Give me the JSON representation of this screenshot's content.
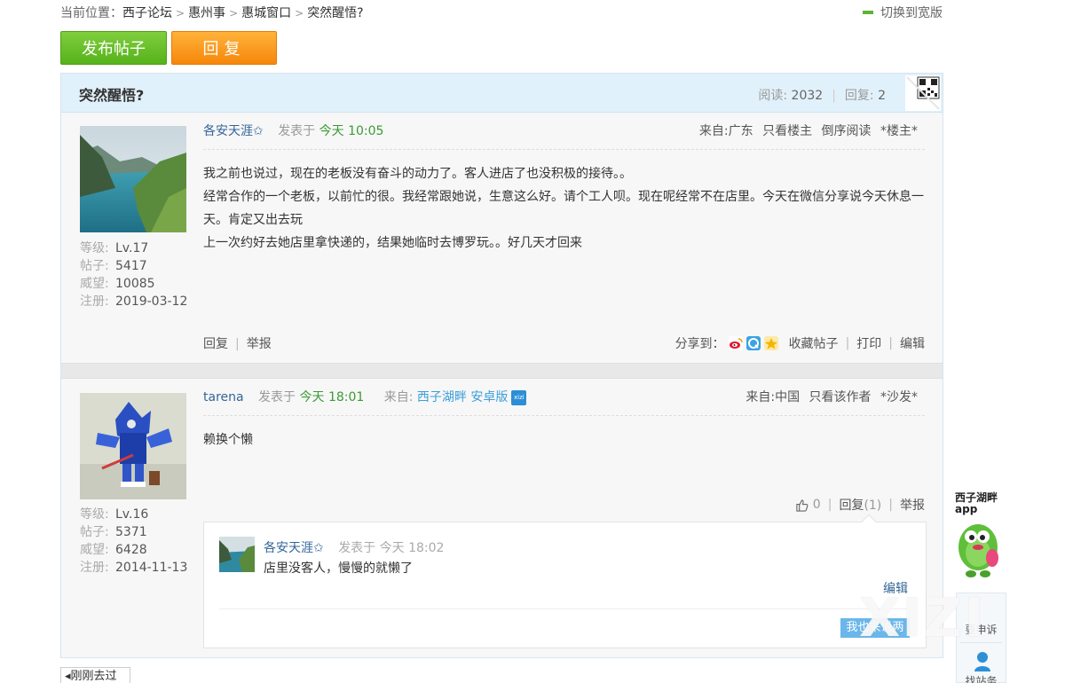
{
  "breadcrumb": {
    "prefix": "当前位置：",
    "items": [
      "西子论坛",
      "惠州事",
      "惠城窗口",
      "突然醒悟?"
    ]
  },
  "wide_toggle": "切换到宽版",
  "buttons": {
    "post": "发布帖子",
    "reply": "回复"
  },
  "thread": {
    "title": "突然醒悟?",
    "read_label": "阅读:",
    "read_count": "2032",
    "reply_label": "回复:",
    "reply_count": "2"
  },
  "posts": [
    {
      "author": "各安天涯✩",
      "posted_label": "发表于",
      "time": "今天 10:05",
      "from": "来自:广东",
      "only_op": "只看楼主",
      "reverse": "倒序阅读",
      "floor": "*楼主*",
      "stats": [
        {
          "k": "等级:",
          "v": "Lv.17"
        },
        {
          "k": "帖子:",
          "v": "5417"
        },
        {
          "k": "威望:",
          "v": "10085"
        },
        {
          "k": "注册:",
          "v": "2019-03-12"
        }
      ],
      "content": [
        "我之前也说过，现在的老板没有奋斗的动力了。客人进店了也没积极的接待。。",
        "经常合作的一个老板，以前忙的很。我经常跟她说，生意这么好。请个工人呗。现在呢经常不在店里。今天在微信分享说今天休息一天。肯定又出去玩",
        "上一次约好去她店里拿快递的，结果她临时去博罗玩。。好几天才回来"
      ],
      "footer": {
        "reply": "回复",
        "report": "举报",
        "share_label": "分享到：",
        "favorite": "收藏帖子",
        "print": "打印",
        "edit": "编辑"
      }
    },
    {
      "author": "tarena",
      "posted_label": "发表于",
      "time": "今天 18:01",
      "from_app_label": "来自:",
      "from_app": "西子湖畔 安卓版",
      "app_badge": "xizi",
      "from": "来自:中国",
      "only_author": "只看该作者",
      "floor": "*沙发*",
      "stats": [
        {
          "k": "等级:",
          "v": "Lv.16"
        },
        {
          "k": "帖子:",
          "v": "5371"
        },
        {
          "k": "威望:",
          "v": "6428"
        },
        {
          "k": "注册:",
          "v": "2014-11-13"
        }
      ],
      "content": "赖换个懒",
      "actions": {
        "like_count": "0",
        "reply": "回复",
        "reply_count": "(1)",
        "report": "举报"
      },
      "sub_reply": {
        "author": "各安天涯✩",
        "posted": "发表于 今天 18:02",
        "text": "店里没客人，慢慢的就懒了",
        "edit": "编辑",
        "me_too": "我也来说两"
      }
    }
  ],
  "back_link": "◂刚刚去过",
  "side": {
    "app_label_1": "西子湖畔",
    "app_label_2": "app",
    "tool1": "要申诉",
    "tool2": "找站务"
  },
  "watermark": "XIZI",
  "colors": {
    "post_button": "#5cb520",
    "reply_button": "#f78a0e",
    "title_bar": "#e1f1fb",
    "link": "#336699",
    "time_green": "#3a9b34"
  }
}
